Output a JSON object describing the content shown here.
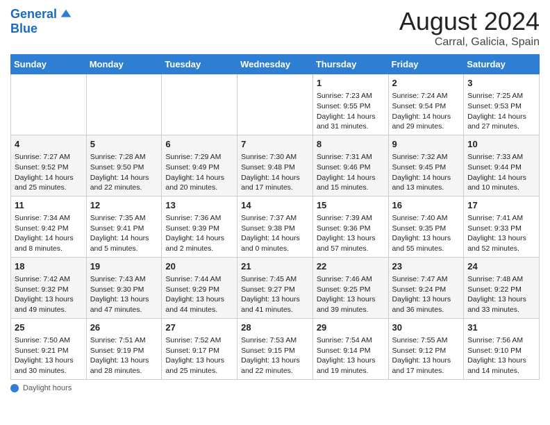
{
  "header": {
    "logo_line1": "General",
    "logo_line2": "Blue",
    "month_title": "August 2024",
    "subtitle": "Carral, Galicia, Spain"
  },
  "weekdays": [
    "Sunday",
    "Monday",
    "Tuesday",
    "Wednesday",
    "Thursday",
    "Friday",
    "Saturday"
  ],
  "weeks": [
    [
      {
        "day": "",
        "info": ""
      },
      {
        "day": "",
        "info": ""
      },
      {
        "day": "",
        "info": ""
      },
      {
        "day": "",
        "info": ""
      },
      {
        "day": "1",
        "info": "Sunrise: 7:23 AM\nSunset: 9:55 PM\nDaylight: 14 hours\nand 31 minutes."
      },
      {
        "day": "2",
        "info": "Sunrise: 7:24 AM\nSunset: 9:54 PM\nDaylight: 14 hours\nand 29 minutes."
      },
      {
        "day": "3",
        "info": "Sunrise: 7:25 AM\nSunset: 9:53 PM\nDaylight: 14 hours\nand 27 minutes."
      }
    ],
    [
      {
        "day": "4",
        "info": "Sunrise: 7:27 AM\nSunset: 9:52 PM\nDaylight: 14 hours\nand 25 minutes."
      },
      {
        "day": "5",
        "info": "Sunrise: 7:28 AM\nSunset: 9:50 PM\nDaylight: 14 hours\nand 22 minutes."
      },
      {
        "day": "6",
        "info": "Sunrise: 7:29 AM\nSunset: 9:49 PM\nDaylight: 14 hours\nand 20 minutes."
      },
      {
        "day": "7",
        "info": "Sunrise: 7:30 AM\nSunset: 9:48 PM\nDaylight: 14 hours\nand 17 minutes."
      },
      {
        "day": "8",
        "info": "Sunrise: 7:31 AM\nSunset: 9:46 PM\nDaylight: 14 hours\nand 15 minutes."
      },
      {
        "day": "9",
        "info": "Sunrise: 7:32 AM\nSunset: 9:45 PM\nDaylight: 14 hours\nand 13 minutes."
      },
      {
        "day": "10",
        "info": "Sunrise: 7:33 AM\nSunset: 9:44 PM\nDaylight: 14 hours\nand 10 minutes."
      }
    ],
    [
      {
        "day": "11",
        "info": "Sunrise: 7:34 AM\nSunset: 9:42 PM\nDaylight: 14 hours\nand 8 minutes."
      },
      {
        "day": "12",
        "info": "Sunrise: 7:35 AM\nSunset: 9:41 PM\nDaylight: 14 hours\nand 5 minutes."
      },
      {
        "day": "13",
        "info": "Sunrise: 7:36 AM\nSunset: 9:39 PM\nDaylight: 14 hours\nand 2 minutes."
      },
      {
        "day": "14",
        "info": "Sunrise: 7:37 AM\nSunset: 9:38 PM\nDaylight: 14 hours\nand 0 minutes."
      },
      {
        "day": "15",
        "info": "Sunrise: 7:39 AM\nSunset: 9:36 PM\nDaylight: 13 hours\nand 57 minutes."
      },
      {
        "day": "16",
        "info": "Sunrise: 7:40 AM\nSunset: 9:35 PM\nDaylight: 13 hours\nand 55 minutes."
      },
      {
        "day": "17",
        "info": "Sunrise: 7:41 AM\nSunset: 9:33 PM\nDaylight: 13 hours\nand 52 minutes."
      }
    ],
    [
      {
        "day": "18",
        "info": "Sunrise: 7:42 AM\nSunset: 9:32 PM\nDaylight: 13 hours\nand 49 minutes."
      },
      {
        "day": "19",
        "info": "Sunrise: 7:43 AM\nSunset: 9:30 PM\nDaylight: 13 hours\nand 47 minutes."
      },
      {
        "day": "20",
        "info": "Sunrise: 7:44 AM\nSunset: 9:29 PM\nDaylight: 13 hours\nand 44 minutes."
      },
      {
        "day": "21",
        "info": "Sunrise: 7:45 AM\nSunset: 9:27 PM\nDaylight: 13 hours\nand 41 minutes."
      },
      {
        "day": "22",
        "info": "Sunrise: 7:46 AM\nSunset: 9:25 PM\nDaylight: 13 hours\nand 39 minutes."
      },
      {
        "day": "23",
        "info": "Sunrise: 7:47 AM\nSunset: 9:24 PM\nDaylight: 13 hours\nand 36 minutes."
      },
      {
        "day": "24",
        "info": "Sunrise: 7:48 AM\nSunset: 9:22 PM\nDaylight: 13 hours\nand 33 minutes."
      }
    ],
    [
      {
        "day": "25",
        "info": "Sunrise: 7:50 AM\nSunset: 9:21 PM\nDaylight: 13 hours\nand 30 minutes."
      },
      {
        "day": "26",
        "info": "Sunrise: 7:51 AM\nSunset: 9:19 PM\nDaylight: 13 hours\nand 28 minutes."
      },
      {
        "day": "27",
        "info": "Sunrise: 7:52 AM\nSunset: 9:17 PM\nDaylight: 13 hours\nand 25 minutes."
      },
      {
        "day": "28",
        "info": "Sunrise: 7:53 AM\nSunset: 9:15 PM\nDaylight: 13 hours\nand 22 minutes."
      },
      {
        "day": "29",
        "info": "Sunrise: 7:54 AM\nSunset: 9:14 PM\nDaylight: 13 hours\nand 19 minutes."
      },
      {
        "day": "30",
        "info": "Sunrise: 7:55 AM\nSunset: 9:12 PM\nDaylight: 13 hours\nand 17 minutes."
      },
      {
        "day": "31",
        "info": "Sunrise: 7:56 AM\nSunset: 9:10 PM\nDaylight: 13 hours\nand 14 minutes."
      }
    ]
  ],
  "footer": {
    "daylight_label": "Daylight hours"
  }
}
